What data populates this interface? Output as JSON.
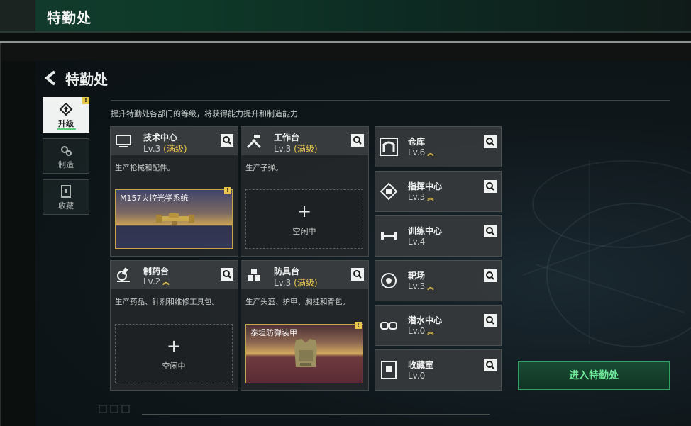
{
  "app": {
    "title": "特勤处"
  },
  "header": {
    "title": "特勤处",
    "description": "提升特勤处各部门的等级，将获得能力提升和制造能力"
  },
  "sidebar": {
    "items": [
      {
        "label": "升级",
        "icon": "upgrade-icon",
        "active": true,
        "badge": "!"
      },
      {
        "label": "制造",
        "icon": "gears-icon",
        "active": false
      },
      {
        "label": "收藏",
        "icon": "collection-icon",
        "active": false
      }
    ]
  },
  "departments": [
    {
      "name": "技术中心",
      "level": "Lv.3",
      "status": "(满级)",
      "description": "生产枪械和配件。",
      "slot": {
        "type": "item",
        "item_name": "M157火控光学系统",
        "badge": "!"
      }
    },
    {
      "name": "工作台",
      "level": "Lv.3",
      "status": "(满级)",
      "description": "生产子弹。",
      "slot": {
        "type": "empty",
        "plus": "+",
        "label": "空闲中"
      }
    },
    {
      "name": "制药台",
      "level": "Lv.2",
      "status": "",
      "upgrade": true,
      "description": "生产药品、针剂和维修工具包。",
      "slot": {
        "type": "empty",
        "plus": "+",
        "label": "空闲中"
      }
    },
    {
      "name": "防具台",
      "level": "Lv.3",
      "status": "(满级)",
      "description": "生产头盔、护甲、胸挂和背包。",
      "slot": {
        "type": "item",
        "item_name": "泰坦防弹装甲",
        "badge": "!"
      }
    }
  ],
  "facilities": [
    {
      "name": "仓库",
      "level": "Lv.6",
      "upgrade": true
    },
    {
      "name": "指挥中心",
      "level": "Lv.3",
      "upgrade": true
    },
    {
      "name": "训练中心",
      "level": "Lv.4",
      "upgrade": false
    },
    {
      "name": "靶场",
      "level": "Lv.3",
      "upgrade": true
    },
    {
      "name": "潜水中心",
      "level": "Lv.0",
      "upgrade": true
    },
    {
      "name": "收藏室",
      "level": "Lv.0",
      "upgrade": false
    }
  ],
  "actions": {
    "enter_label": "进入特勤处"
  },
  "colors": {
    "accent_green": "#6fe89a",
    "max_level_gold": "#e8c64b"
  }
}
